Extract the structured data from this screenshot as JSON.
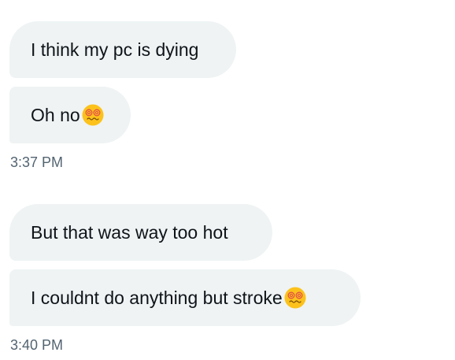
{
  "messages": [
    {
      "text": "I think my pc is dying",
      "emoji": null
    },
    {
      "text": "Oh no",
      "emoji": "dizzy-face-emoji"
    },
    {
      "text": "But that was way too hot",
      "emoji": null
    },
    {
      "text": "I couldnt do anything but stroke",
      "emoji": "dizzy-face-emoji"
    }
  ],
  "timestamps": [
    "3:37 PM",
    "3:40 PM"
  ],
  "colors": {
    "bubble_bg": "#eff3f4",
    "text": "#0f1419",
    "timestamp": "#536471",
    "emoji_face": "#fcc21b",
    "emoji_eyes": "#e2504a"
  }
}
